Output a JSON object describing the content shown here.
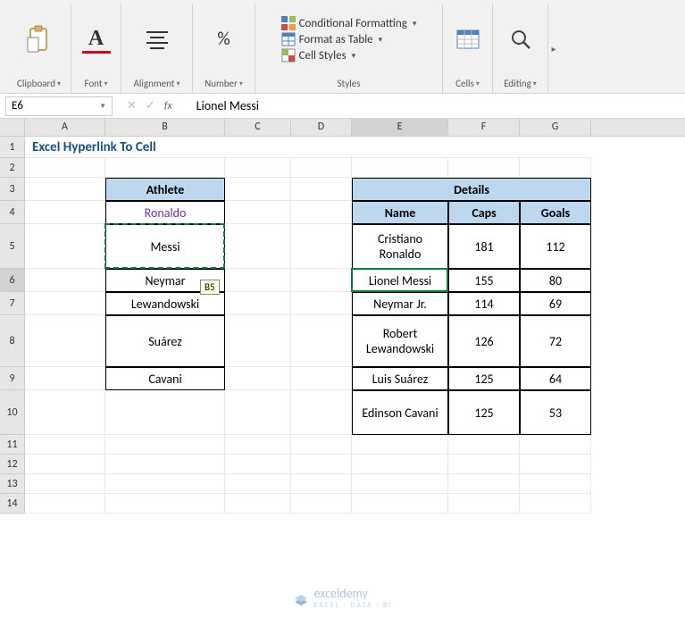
{
  "ribbon": {
    "clipboard": "Clipboard",
    "font": "Font",
    "alignment": "Alignment",
    "number": "Number",
    "styles": "Styles",
    "cells": "Cells",
    "editing": "Editing",
    "cond_format": "Conditional Formatting",
    "format_table": "Format as Table",
    "cell_styles": "Cell Styles"
  },
  "namebox": "E6",
  "formula": "Lionel Messi",
  "columns": [
    "A",
    "B",
    "C",
    "D",
    "E",
    "F",
    "G"
  ],
  "rows": [
    "1",
    "2",
    "3",
    "4",
    "5",
    "6",
    "7",
    "8",
    "9",
    "10",
    "11",
    "12",
    "13",
    "14"
  ],
  "title": "Excel Hyperlink To Cell",
  "athlete_header": "Athlete",
  "athletes": [
    "Ronaldo",
    "Messi",
    "Neymar",
    "Lewandowski",
    "Suárez",
    "Cavani"
  ],
  "details_header": "Details",
  "details_cols": {
    "name": "Name",
    "caps": "Caps",
    "goals": "Goals"
  },
  "details": [
    {
      "name": "Cristiano Ronaldo",
      "caps": "181",
      "goals": "112"
    },
    {
      "name": "Lionel Messi",
      "caps": "155",
      "goals": "80"
    },
    {
      "name": "Neymar Jr.",
      "caps": "114",
      "goals": "69"
    },
    {
      "name": "Robert Lewandowski",
      "caps": "126",
      "goals": "72"
    },
    {
      "name": "Luis Suárez",
      "caps": "125",
      "goals": "64"
    },
    {
      "name": "Edinson Cavani",
      "caps": "125",
      "goals": "53"
    }
  ],
  "tooltip": "B5",
  "watermark": {
    "name": "exceldemy",
    "sub": "EXCEL · DATA · BI"
  }
}
